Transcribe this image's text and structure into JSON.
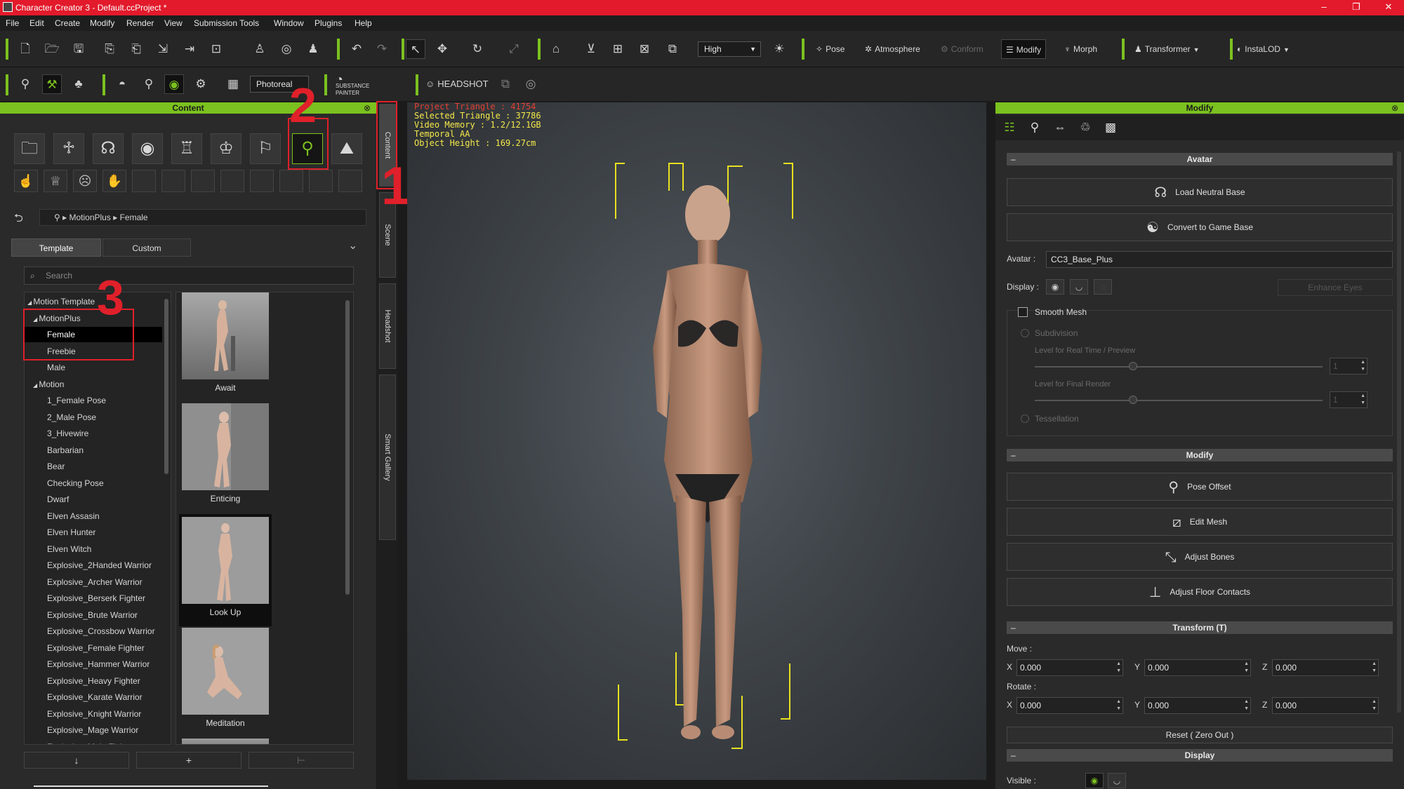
{
  "window": {
    "title": "Character Creator 3 - Default.ccProject *",
    "controls": [
      "–",
      "❐",
      "✕"
    ]
  },
  "menu": [
    "File",
    "Edit",
    "Create",
    "Modify",
    "Render",
    "View",
    "Submission Tools",
    "Window",
    "Plugins",
    "Help"
  ],
  "toolbar": {
    "quality_value": "High",
    "pose_label": "Pose",
    "atmosphere_label": "Atmosphere",
    "conform_label": "Conform",
    "modify_label": "Modify",
    "morph_label": "Morph",
    "transformer_label": "Transformer",
    "instalod_label": "InstaLOD",
    "render_mode_value": "Photoreal",
    "substance_label_1": "SUBSTANCE",
    "substance_label_2": "PAINTER",
    "headshot_label": "HEADSHOT"
  },
  "content_panel": {
    "title": "Content",
    "breadcrumb": [
      "MotionPlus",
      "Female"
    ],
    "tabs": [
      "Template",
      "Custom"
    ],
    "search_placeholder": "Search",
    "tree": [
      {
        "label": "Motion Template",
        "level": 0,
        "expanded": true
      },
      {
        "label": "MotionPlus",
        "level": 1,
        "expanded": true
      },
      {
        "label": "Female",
        "level": 2,
        "selected": true
      },
      {
        "label": "Freebie",
        "level": 2
      },
      {
        "label": "Male",
        "level": 2
      },
      {
        "label": "Motion",
        "level": 1,
        "expanded": true
      },
      {
        "label": "1_Female Pose",
        "level": 2
      },
      {
        "label": "2_Male Pose",
        "level": 2
      },
      {
        "label": "3_Hivewire",
        "level": 2
      },
      {
        "label": "Barbarian",
        "level": 2
      },
      {
        "label": "Bear",
        "level": 2
      },
      {
        "label": "Checking Pose",
        "level": 2
      },
      {
        "label": "Dwarf",
        "level": 2
      },
      {
        "label": "Elven Assasin",
        "level": 2
      },
      {
        "label": "Elven Hunter",
        "level": 2
      },
      {
        "label": "Elven Witch",
        "level": 2
      },
      {
        "label": "Explosive_2Handed Warrior",
        "level": 2
      },
      {
        "label": "Explosive_Archer Warrior",
        "level": 2
      },
      {
        "label": "Explosive_Berserk Fighter",
        "level": 2
      },
      {
        "label": "Explosive_Brute Warrior",
        "level": 2
      },
      {
        "label": "Explosive_Crossbow Warrior",
        "level": 2
      },
      {
        "label": "Explosive_Female Fighter",
        "level": 2
      },
      {
        "label": "Explosive_Hammer Warrior",
        "level": 2
      },
      {
        "label": "Explosive_Heavy Fighter",
        "level": 2
      },
      {
        "label": "Explosive_Karate Warrior",
        "level": 2
      },
      {
        "label": "Explosive_Knight Warrior",
        "level": 2
      },
      {
        "label": "Explosive_Mage Warrior",
        "level": 2
      },
      {
        "label": "Explosive_Male Fighter",
        "level": 2
      }
    ],
    "items": [
      {
        "label": "Await"
      },
      {
        "label": "Enticing"
      },
      {
        "label": "Look Up",
        "selected": true
      },
      {
        "label": "Meditation"
      }
    ],
    "bottom_buttons": [
      "↓",
      "+",
      "⊢"
    ]
  },
  "side_tabs": [
    "Content",
    "Scene",
    "Headshot",
    "Smart Gallery"
  ],
  "annotations": [
    "1",
    "2",
    "3"
  ],
  "viewport": {
    "stats": {
      "project_triangle": "Project Triangle : 41754",
      "selected_triangle": "Selected Triangle : 37786",
      "video_memory": "Video Memory : 1.2/12.1GB",
      "temporal_aa": "Temporal AA",
      "object_height": "Object Height : 169.27cm"
    }
  },
  "modify_panel": {
    "title": "Modify",
    "avatar_section": {
      "title": "Avatar",
      "load_neutral_base": "Load Neutral Base",
      "convert_to_game_base": "Convert to Game Base",
      "avatar_label": "Avatar :",
      "avatar_value": "CC3_Base_Plus",
      "display_label": "Display :",
      "enhance_eyes": "Enhance Eyes",
      "smooth_mesh": "Smooth Mesh",
      "smooth_mesh_checked": false,
      "subdivision": "Subdivision",
      "level_realtime": "Level for Real Time / Preview",
      "level_realtime_value": "1",
      "level_final": "Level for Final Render",
      "level_final_value": "1",
      "tessellation": "Tessellation"
    },
    "modify_section": {
      "title": "Modify",
      "pose_offset": "Pose Offset",
      "edit_mesh": "Edit Mesh",
      "adjust_bones": "Adjust Bones",
      "adjust_floor_contacts": "Adjust Floor Contacts"
    },
    "transform_section": {
      "title": "Transform  (T)",
      "move_label": "Move :",
      "rotate_label": "Rotate :",
      "move": {
        "x": "0.000",
        "y": "0.000",
        "z": "0.000"
      },
      "rotate": {
        "x": "0.000",
        "y": "0.000",
        "z": "0.000"
      },
      "axis_x": "X",
      "axis_y": "Y",
      "axis_z": "Z",
      "reset": "Reset ( Zero Out )"
    },
    "display_section": {
      "title": "Display",
      "visible_label": "Visible :"
    }
  },
  "colors": {
    "accent_green": "#7bc11f",
    "titlebar_red": "#e21a2b",
    "annotation_red": "#e0202a",
    "stats_yellow": "#f5e84a"
  }
}
